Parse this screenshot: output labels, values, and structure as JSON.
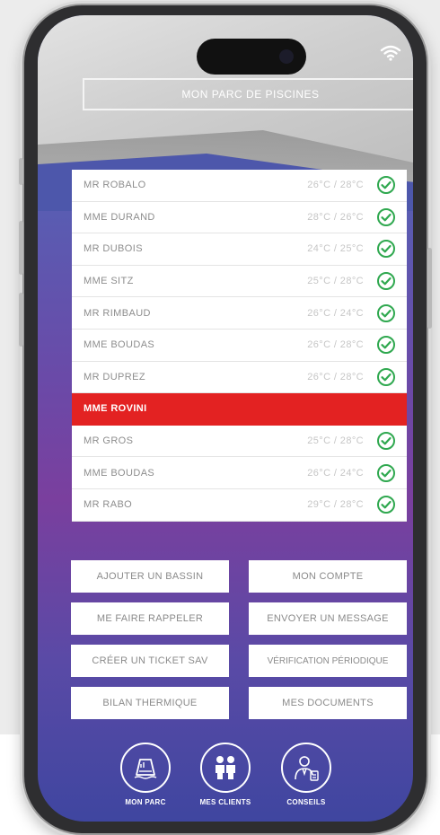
{
  "app": {
    "title": "MON PARC DE PISCINES"
  },
  "pools": [
    {
      "name": "MR ROBALO",
      "temp": "26°C / 28°C",
      "status": "ok"
    },
    {
      "name": "MME DURAND",
      "temp": "28°C / 26°C",
      "status": "ok"
    },
    {
      "name": "MR DUBOIS",
      "temp": "24°C / 25°C",
      "status": "ok"
    },
    {
      "name": "MME SITZ",
      "temp": "25°C / 28°C",
      "status": "ok"
    },
    {
      "name": "MR RIMBAUD",
      "temp": "26°C / 24°C",
      "status": "ok"
    },
    {
      "name": "MME BOUDAS",
      "temp": "26°C / 28°C",
      "status": "ok"
    },
    {
      "name": "MR DUPREZ",
      "temp": "26°C / 28°C",
      "status": "ok"
    },
    {
      "name": "MME ROVINI",
      "temp": "",
      "status": "alert"
    },
    {
      "name": "MR GROS",
      "temp": "25°C / 28°C",
      "status": "ok"
    },
    {
      "name": "MME BOUDAS",
      "temp": "26°C / 24°C",
      "status": "ok"
    },
    {
      "name": "MR RABO",
      "temp": "29°C / 28°C",
      "status": "ok"
    }
  ],
  "actions": {
    "add_pool": "AJOUTER UN BASSIN",
    "my_account": "MON COMPTE",
    "call_back": "ME FAIRE RAPPELER",
    "send_message": "ENVOYER UN MESSAGE",
    "create_ticket": "CRÉER UN TICKET SAV",
    "periodic_check": "VÉRIFICATION PÉRIODIQUE",
    "thermal_report": "BILAN THERMIQUE",
    "my_documents": "MES DOCUMENTS"
  },
  "nav": {
    "park": "MON PARC",
    "clients": "MES CLIENTS",
    "advice": "CONSEILS"
  },
  "colors": {
    "alert": "#e32222",
    "ok": "#2fa84f",
    "accent_top": "#4f58a8",
    "accent_mid": "#7a3f9e"
  }
}
